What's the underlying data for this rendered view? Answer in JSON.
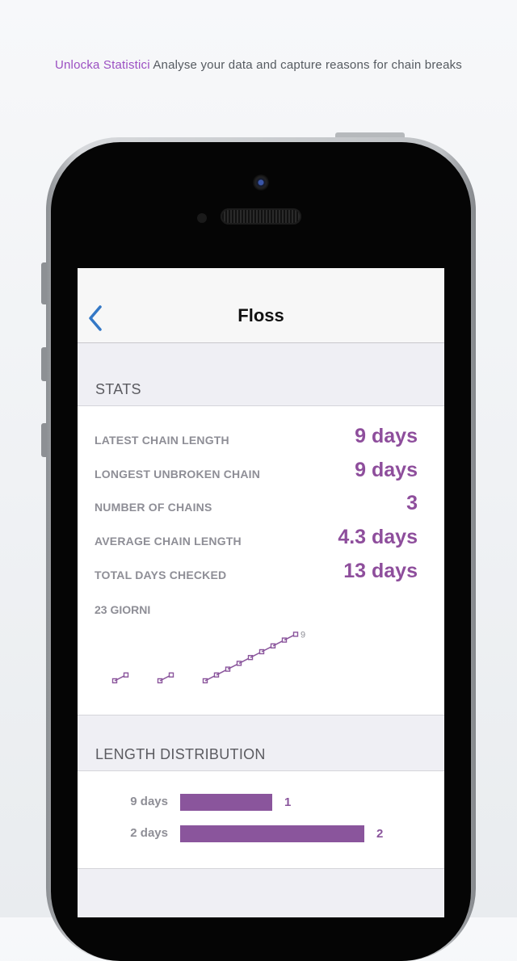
{
  "caption": {
    "highlight": "Unlocka Statistici",
    "text": " Analyse your data and capture reasons for chain breaks"
  },
  "navbar": {
    "title": "Floss",
    "back_icon": "chevron-left-icon"
  },
  "stats_section": {
    "header": "STATS",
    "rows": [
      {
        "label": "LATEST CHAIN LENGTH",
        "value": "9 days"
      },
      {
        "label": "LONGEST UNBROKEN CHAIN",
        "value": "9 days"
      },
      {
        "label": "NUMBER OF CHAINS",
        "value": "3"
      },
      {
        "label": "AVERAGE CHAIN LENGTH",
        "value": "4.3 days"
      },
      {
        "label": "TOTAL DAYS CHECKED",
        "value": "13 days"
      }
    ],
    "chart_label": "23 GIORNI",
    "chart_end_label": "9"
  },
  "distribution_section": {
    "header": "LENGTH DISTRIBUTION",
    "rows": [
      {
        "label": "9 days",
        "count": "1"
      },
      {
        "label": "2 days",
        "count": "2"
      }
    ]
  },
  "colors": {
    "accent": "#8a559c",
    "back_button": "#3478c6"
  },
  "chart_data": [
    {
      "type": "line",
      "title": "23 GIORNI",
      "x": [
        1,
        2,
        3,
        4,
        5,
        6,
        7,
        8,
        9,
        10,
        11,
        12,
        13,
        14,
        15,
        16,
        17,
        18,
        19,
        20,
        21,
        22,
        23
      ],
      "series": [
        {
          "values": [
            1,
            2,
            null,
            null,
            1,
            2,
            null,
            null,
            1,
            2,
            3,
            4,
            5,
            6,
            7,
            8,
            9,
            null,
            null,
            null,
            null,
            null,
            null
          ]
        }
      ],
      "end_label": "9",
      "note_segments": [
        [
          1,
          2
        ],
        [
          1,
          2
        ],
        [
          1,
          2,
          3,
          4,
          5,
          6,
          7,
          8,
          9
        ]
      ]
    },
    {
      "type": "bar",
      "orientation": "horizontal",
      "title": "LENGTH DISTRIBUTION",
      "categories": [
        "9 days",
        "2 days"
      ],
      "values": [
        1,
        2
      ]
    }
  ]
}
